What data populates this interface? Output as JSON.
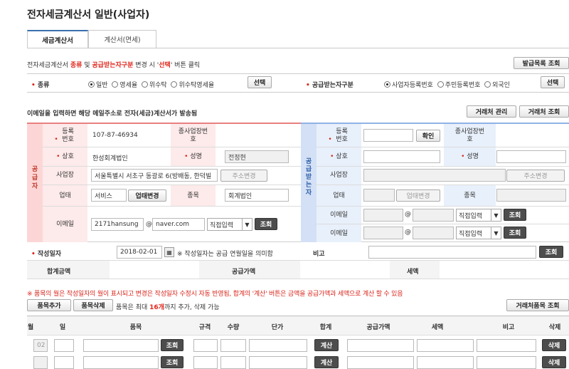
{
  "page": {
    "title": "전자세금계산서 일반(사업자)"
  },
  "tabs": [
    {
      "label": "세금계산서",
      "active": true
    },
    {
      "label": "계산서(면세)",
      "active": false
    }
  ],
  "notice": {
    "part1": "전자세금계산서 ",
    "kind": "종류",
    "part2": " 및 ",
    "receiver_type": "공급받는자구분",
    "part3": " 변경 시 '",
    "select": "선택",
    "part4": "' 버튼 클릭"
  },
  "issue_list_button": "발급목록 조회",
  "kind_row": {
    "label": "종류",
    "options": [
      "일반",
      "영세율",
      "위수탁",
      "위수탁영세율"
    ],
    "selected": 0,
    "select_button": "선택"
  },
  "receiver_row": {
    "label": "공급받는자구분",
    "options": [
      "사업자등록번호",
      "주민등록번호",
      "외국인"
    ],
    "selected": 0,
    "select_button": "선택"
  },
  "email_notice": "이메일을 입력하면 해당 메일주소로 전자(세금)계산서가 발송됨",
  "partner_manage_button": "거래처 관리",
  "partner_search_button": "거래처 조회",
  "supplier": {
    "side_label": "공급자",
    "reg_no_label": "등록번호",
    "reg_no": "107-87-46934",
    "branch_label": "종사업장번호",
    "name_label": "상호",
    "name": "한성회계법인",
    "rep_label": "성명",
    "rep": "전정현",
    "address_label": "사업장",
    "address": "서울특별시 서초구 동광로 6(방배동, 한덕빌",
    "address_button": "주소변경",
    "biz_type_label": "업태",
    "biz_type": "서비스",
    "biz_type_button": "업태변경",
    "item_label": "종목",
    "item": "회계법인",
    "email_label": "이메일",
    "email_id": "2171hansung",
    "at": "@",
    "email_domain": "naver.com",
    "domain_select": "직접입력",
    "search_button": "조회"
  },
  "buyer": {
    "side_label": "공급받는자",
    "reg_no_label": "등록번호",
    "confirm_button": "확인",
    "branch_label": "종사업장번호",
    "name_label": "상호",
    "rep_label": "성명",
    "address_label": "사업장",
    "address_button": "주소변경",
    "biz_type_label": "업태",
    "biz_type_button": "업태변경",
    "item_label": "종목",
    "email_label": "이메일",
    "at": "@",
    "domain_select": "직접입력",
    "search_button": "조회",
    "email2_label": "이메일",
    "domain_select2": "직접입력",
    "search_button2": "조회"
  },
  "write_date": {
    "label": "작성일자",
    "value": "2018-02-01",
    "note": "※ 작성일자는 공급 연월일을 의미함",
    "remark_label": "비고",
    "remark_button": "조회"
  },
  "totals": {
    "total_label": "합계금액",
    "supply_label": "공급가액",
    "tax_label": "세액"
  },
  "items_notice": "※ 품목의 월은 작성일자의 월이 표시되고 변경은 작성일자 수정시 자동 반영됨, 합계의 '계산' 버튼은 금액을 공급가액과 세액으로 계산 할 수 있음",
  "add_item_button": "품목추가",
  "delete_item_button": "품목삭제",
  "item_limit": {
    "before": "품목은 최대 ",
    "count": "16개",
    "after": "까지 추가, 삭제 가능"
  },
  "partner_item_search_button": "거래처품목 조회",
  "item_table": {
    "headers": [
      "월",
      "일",
      "품목",
      "규격",
      "수량",
      "단가",
      "합계",
      "공급가액",
      "세액",
      "비고",
      "삭제"
    ],
    "rows": [
      {
        "month": "02",
        "search": "조회",
        "calc": "계산",
        "delete": "삭제"
      },
      {
        "month": "",
        "search": "조회",
        "calc": "계산",
        "delete": "삭제"
      }
    ]
  }
}
